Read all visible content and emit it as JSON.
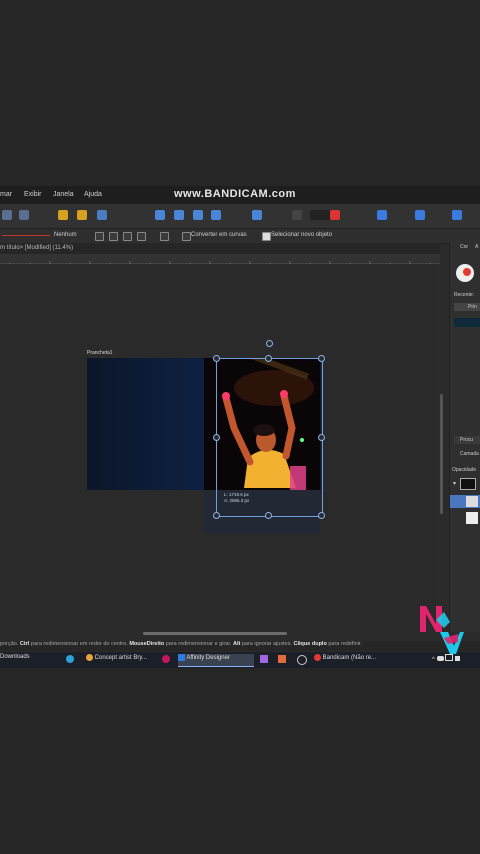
{
  "watermark": "www.BANDICAM.com",
  "menu": {
    "items": [
      "mar",
      "Exibir",
      "Janela",
      "Ajuda"
    ]
  },
  "context_toolbar": {
    "stroke_label": "Nenhum",
    "convert_button": "Converter em curvas",
    "select_new_label": "Selecionar novo objeto"
  },
  "document": {
    "title": "m título> [Modified] (11.4%)"
  },
  "canvas": {
    "artboard_label": "Prancheta1",
    "dims_width": "L: 1719.6 px",
    "dims_height": "A: 2565.3 px"
  },
  "panel": {
    "tab_a": "Cor",
    "tab_b": "A",
    "recent_label": "Recente:",
    "swatch_label": "Prin",
    "search_placeholder": "Procu",
    "layers_label": "Camada",
    "opacity_label": "Opacidade"
  },
  "status": {
    "p1": "porção. ",
    "ctrl": "Ctrl",
    "p2": " para redimensionar em redor do centro. ",
    "mouse": "MouseDireito",
    "p3": " para redimensionar e girar. ",
    "alt": "Alt",
    "p4": " para ignorar ajustes. ",
    "dbl": "Clique duplo",
    "p5": " para redefinir."
  },
  "taskbar": {
    "items": [
      "Downloads",
      "Concept artist Bry...",
      "Affinity Designer",
      "Bandicam (Não re..."
    ]
  },
  "colors": {
    "accent": "#6f9fe0",
    "artboard": "#0e2040",
    "brand_red": "#e53935"
  }
}
